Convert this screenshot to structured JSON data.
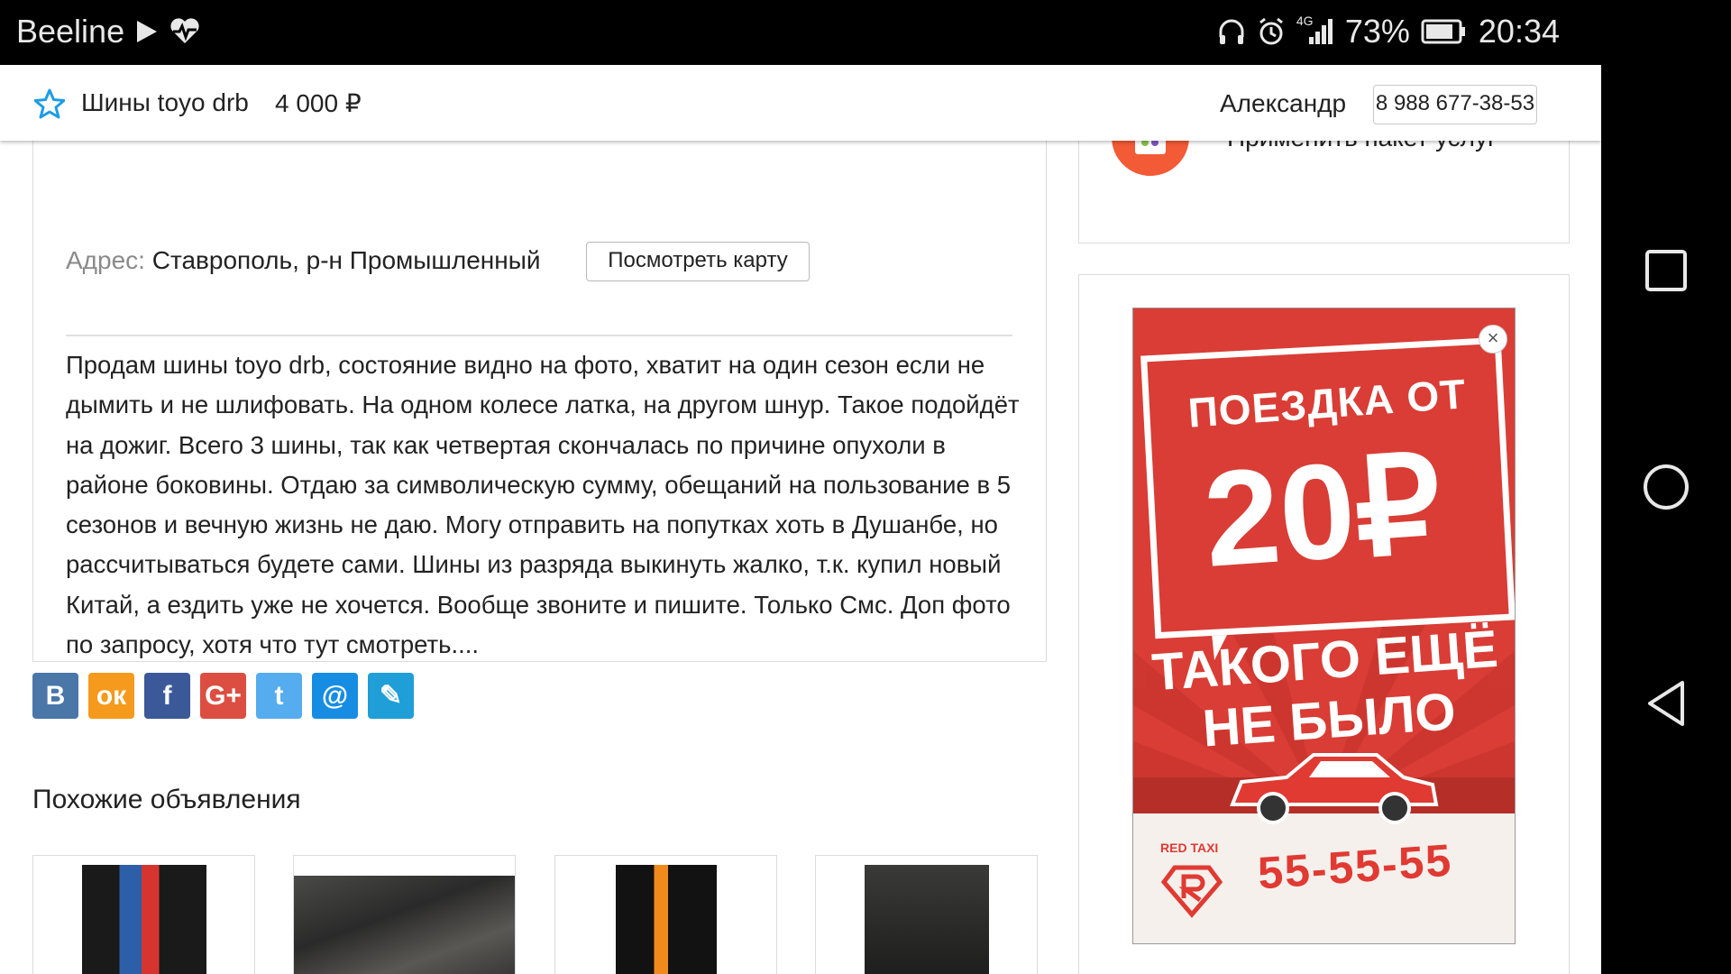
{
  "status_bar": {
    "carrier": "Beeline",
    "battery": "73%",
    "time": "20:34",
    "network": "4G"
  },
  "header": {
    "title": "Шины toyo drb",
    "price": "4 000 ₽",
    "seller_name": "Александр",
    "phone": "8 988 677-38-53"
  },
  "listing": {
    "address_label": "Адрес:",
    "address_value": "Ставрополь, р-н Промышленный",
    "map_button": "Посмотреть карту",
    "description": "Продам шины toyo drb, состояние видно на фото, хватит на один сезон если не дымить и не шлифовать. На одном колесе латка, на другом шнур. Такое подойдёт на дожиг. Всего 3 шины, так как четвертая скончалась по причине опухоли в районе боковины. Отдаю за символическую сумму, обещаний на пользование в 5 сезонов и вечную жизнь не даю. Могу отправить на попутках хоть в Душанбе, но рассчитываться будете сами. Шины из разряда выкинуть жалко, т.к. купил новый Китай, а ездить уже не хочется. Вообще звоните и пишите. Только Смс. Доп фото по запросу, хотя что тут смотреть...."
  },
  "share": {
    "buttons": [
      {
        "icon": "vk-icon",
        "glyph": "В",
        "color": "#4a76a8"
      },
      {
        "icon": "odnoklassniki-icon",
        "glyph": "ок",
        "color": "#f59a1c"
      },
      {
        "icon": "facebook-icon",
        "glyph": "f",
        "color": "#3b5998"
      },
      {
        "icon": "google-plus-icon",
        "glyph": "G+",
        "color": "#dc4e41"
      },
      {
        "icon": "twitter-icon",
        "glyph": "t",
        "color": "#55acee"
      },
      {
        "icon": "mailru-icon",
        "glyph": "@",
        "color": "#168de2"
      },
      {
        "icon": "livejournal-icon",
        "glyph": "✎",
        "color": "#1f9ed8"
      }
    ]
  },
  "similar": {
    "title": "Похожие объявления"
  },
  "services": {
    "label": "Применить пакет услуг"
  },
  "ad": {
    "line1": "ПОЕЗДКА ОТ",
    "line2": "20₽",
    "line3": "ТАКОГО ЕЩЁ НЕ БЫЛО",
    "brand": "RED TAXI",
    "phone": "55-55-55",
    "close": "×"
  }
}
